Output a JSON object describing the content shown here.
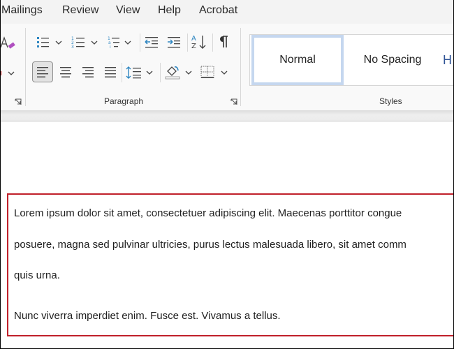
{
  "tabs": [
    {
      "label": "Mailings"
    },
    {
      "label": "Review"
    },
    {
      "label": "View"
    },
    {
      "label": "Help"
    },
    {
      "label": "Acrobat"
    }
  ],
  "ribbon": {
    "paragraph_group": {
      "label": "Paragraph",
      "buttons": [
        {
          "name": "bullets",
          "tooltip": "Bullets"
        },
        {
          "name": "numbering",
          "tooltip": "Numbering"
        },
        {
          "name": "multilevel-list",
          "tooltip": "Multilevel List"
        },
        {
          "name": "decrease-indent",
          "tooltip": "Decrease Indent"
        },
        {
          "name": "increase-indent",
          "tooltip": "Increase Indent"
        },
        {
          "name": "sort",
          "tooltip": "Sort"
        },
        {
          "name": "show-hide",
          "tooltip": "Show/Hide ¶"
        },
        {
          "name": "align-left",
          "tooltip": "Align Left",
          "active": true
        },
        {
          "name": "center",
          "tooltip": "Center"
        },
        {
          "name": "align-right",
          "tooltip": "Align Right"
        },
        {
          "name": "justify",
          "tooltip": "Justify"
        },
        {
          "name": "line-spacing",
          "tooltip": "Line and Paragraph Spacing"
        },
        {
          "name": "shading",
          "tooltip": "Shading"
        },
        {
          "name": "borders",
          "tooltip": "Borders"
        }
      ]
    },
    "styles_group": {
      "label": "Styles",
      "items": [
        {
          "label": "Normal",
          "selected": true
        },
        {
          "label": "No Spacing",
          "selected": false
        },
        {
          "label": "H",
          "selected": false
        }
      ]
    },
    "colors": {
      "accent_blue": "#2e86c1",
      "eraser_purple": "#b04fc0",
      "selected_style_border": "#c5d7ef"
    }
  },
  "document": {
    "highlight_color": "#c0202a",
    "lines": [
      "Lorem ipsum dolor sit amet, consectetuer adipiscing elit. Maecenas porttitor congue",
      "posuere, magna sed pulvinar ultricies, purus lectus malesuada libero, sit amet comm",
      "quis urna.",
      "Nunc viverra imperdiet enim. Fusce est. Vivamus a tellus."
    ]
  }
}
